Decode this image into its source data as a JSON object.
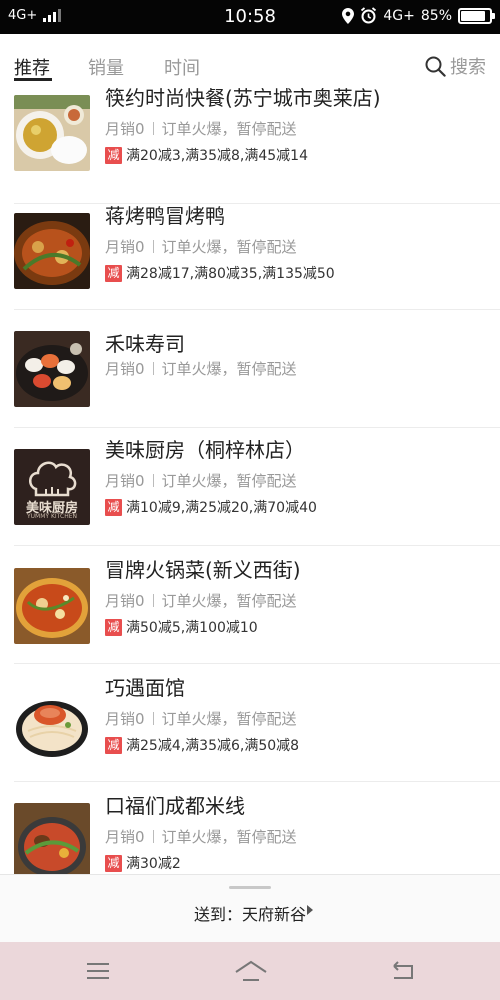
{
  "status_bar": {
    "carrier": "4G+",
    "time": "10:58",
    "network": "4G+",
    "battery_text": "85%",
    "battery_level": 0.85
  },
  "tabs": {
    "items": [
      "推荐",
      "销量",
      "时间"
    ],
    "active_index": 0,
    "search_label": "搜索"
  },
  "restaurants": [
    {
      "name": "筷约时尚快餐(苏宁城市奥莱店)",
      "sales": "月销0",
      "status": "订单火爆，暂停配送",
      "promo_tag": "减",
      "promo": "满20减3,满35减8,满45减14"
    },
    {
      "name": "蒋烤鸭冒烤鸭",
      "sales": "月销0",
      "status": "订单火爆，暂停配送",
      "promo_tag": "减",
      "promo": "满28减17,满80减35,满135减50"
    },
    {
      "name": "禾味寿司",
      "sales": "月销0",
      "status": "订单火爆，暂停配送",
      "promo_tag": "",
      "promo": ""
    },
    {
      "name": "美味厨房（桐梓林店）",
      "sales": "月销0",
      "status": "订单火爆，暂停配送",
      "promo_tag": "减",
      "promo": "满10减9,满25减20,满70减40",
      "logo_text": "美味厨房",
      "logo_subtext": "YUMMY KITCHEN"
    },
    {
      "name": "冒牌火锅菜(新义西街)",
      "sales": "月销0",
      "status": "订单火爆，暂停配送",
      "promo_tag": "减",
      "promo": "满50减5,满100减10"
    },
    {
      "name": "巧遇面馆",
      "sales": "月销0",
      "status": "订单火爆，暂停配送",
      "promo_tag": "减",
      "promo": "满25减4,满35减6,满50减8"
    },
    {
      "name": "口福们成都米线",
      "sales": "月销0",
      "status": "订单火爆，暂停配送",
      "promo_tag": "减",
      "promo": "满30减2"
    }
  ],
  "delivery": {
    "label": "送到：天府新谷"
  },
  "navbar": {
    "icons": [
      "menu-icon",
      "home-icon",
      "back-icon"
    ]
  }
}
